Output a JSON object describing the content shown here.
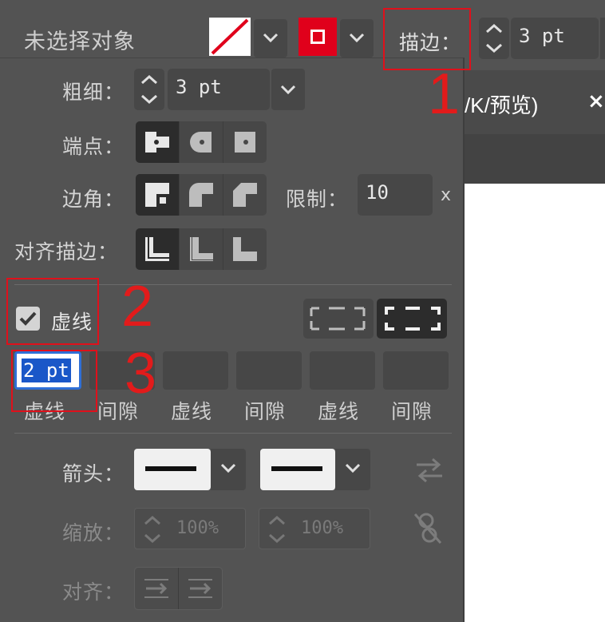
{
  "topbar": {
    "selection_label": "未选择对象",
    "stroke_label": "描边：",
    "stroke_weight": "3 pt"
  },
  "document_tab": {
    "title": "/K/预览)",
    "close": "×"
  },
  "stroke_panel": {
    "weight_label": "粗细：",
    "weight_value": "3 pt",
    "cap_label": "端点：",
    "corner_label": "边角：",
    "limit_label": "限制：",
    "limit_value": "10",
    "limit_unit": "x",
    "align_label": "对齐描边：",
    "dashed_label": "虚线",
    "dashed_checked": true,
    "dash_fields": [
      {
        "value": "2 pt",
        "caption": "虚线"
      },
      {
        "value": "",
        "caption": "间隙"
      },
      {
        "value": "",
        "caption": "虚线"
      },
      {
        "value": "",
        "caption": "间隙"
      },
      {
        "value": "",
        "caption": "虚线"
      },
      {
        "value": "",
        "caption": "间隙"
      }
    ],
    "arrow_label": "箭头：",
    "scale_label": "缩放：",
    "scale_start": "100%",
    "scale_end": "100%",
    "align_arrow_label": "对齐："
  },
  "annotations": [
    "1",
    "2",
    "3"
  ],
  "colors": {
    "panel_bg": "#535353",
    "stroke_color": "#e0001b",
    "annotation_red": "#e21b1b",
    "selection_blue": "#1a57c8"
  }
}
